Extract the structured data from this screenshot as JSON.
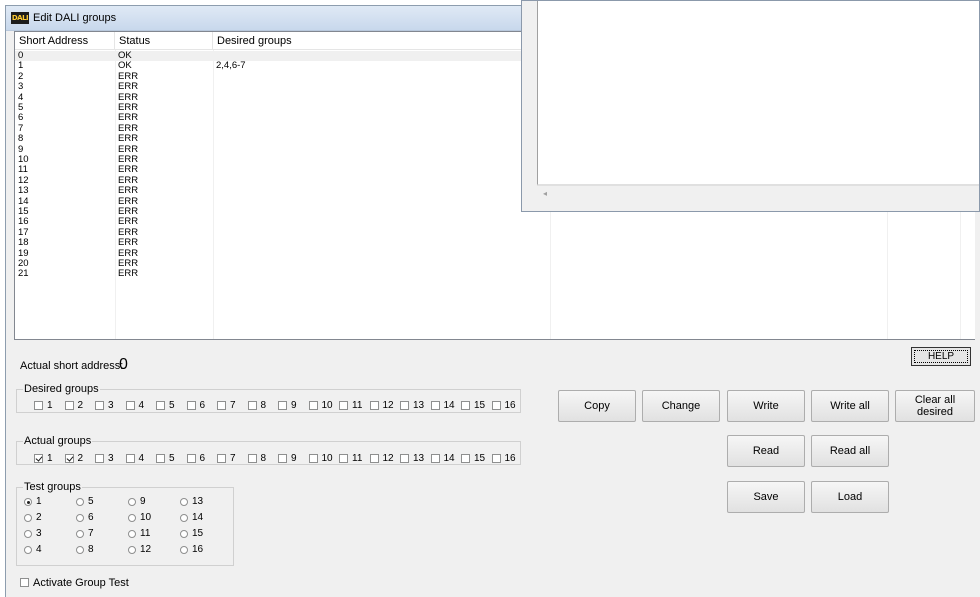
{
  "window": {
    "title": "Edit DALI groups",
    "icon_text": "DALI"
  },
  "list": {
    "columns": [
      "Short Address",
      "Status",
      "Desired groups"
    ],
    "rows": [
      {
        "address": "0",
        "status": "OK",
        "desired": ""
      },
      {
        "address": "1",
        "status": "OK",
        "desired": "2,4,6-7"
      },
      {
        "address": "2",
        "status": "ERR",
        "desired": ""
      },
      {
        "address": "3",
        "status": "ERR",
        "desired": ""
      },
      {
        "address": "4",
        "status": "ERR",
        "desired": ""
      },
      {
        "address": "5",
        "status": "ERR",
        "desired": ""
      },
      {
        "address": "6",
        "status": "ERR",
        "desired": ""
      },
      {
        "address": "7",
        "status": "ERR",
        "desired": ""
      },
      {
        "address": "8",
        "status": "ERR",
        "desired": ""
      },
      {
        "address": "9",
        "status": "ERR",
        "desired": ""
      },
      {
        "address": "10",
        "status": "ERR",
        "desired": ""
      },
      {
        "address": "11",
        "status": "ERR",
        "desired": ""
      },
      {
        "address": "12",
        "status": "ERR",
        "desired": ""
      },
      {
        "address": "13",
        "status": "ERR",
        "desired": ""
      },
      {
        "address": "14",
        "status": "ERR",
        "desired": ""
      },
      {
        "address": "15",
        "status": "ERR",
        "desired": ""
      },
      {
        "address": "16",
        "status": "ERR",
        "desired": ""
      },
      {
        "address": "17",
        "status": "ERR",
        "desired": ""
      },
      {
        "address": "18",
        "status": "ERR",
        "desired": ""
      },
      {
        "address": "19",
        "status": "ERR",
        "desired": ""
      },
      {
        "address": "20",
        "status": "ERR",
        "desired": ""
      },
      {
        "address": "21",
        "status": "ERR",
        "desired": ""
      }
    ]
  },
  "actual_short_address": {
    "label": "Actual short address:",
    "value": "0"
  },
  "help_label": "HELP",
  "desired_groups": {
    "legend": "Desired groups",
    "items": [
      {
        "label": "1",
        "checked": false
      },
      {
        "label": "2",
        "checked": false
      },
      {
        "label": "3",
        "checked": false
      },
      {
        "label": "4",
        "checked": false
      },
      {
        "label": "5",
        "checked": false
      },
      {
        "label": "6",
        "checked": false
      },
      {
        "label": "7",
        "checked": false
      },
      {
        "label": "8",
        "checked": false
      },
      {
        "label": "9",
        "checked": false
      },
      {
        "label": "10",
        "checked": false
      },
      {
        "label": "11",
        "checked": false
      },
      {
        "label": "12",
        "checked": false
      },
      {
        "label": "13",
        "checked": false
      },
      {
        "label": "14",
        "checked": false
      },
      {
        "label": "15",
        "checked": false
      },
      {
        "label": "16",
        "checked": false
      }
    ]
  },
  "actual_groups": {
    "legend": "Actual groups",
    "items": [
      {
        "label": "1",
        "checked": true
      },
      {
        "label": "2",
        "checked": true
      },
      {
        "label": "3",
        "checked": false
      },
      {
        "label": "4",
        "checked": false
      },
      {
        "label": "5",
        "checked": false
      },
      {
        "label": "6",
        "checked": false
      },
      {
        "label": "7",
        "checked": false
      },
      {
        "label": "8",
        "checked": false
      },
      {
        "label": "9",
        "checked": false
      },
      {
        "label": "10",
        "checked": false
      },
      {
        "label": "11",
        "checked": false
      },
      {
        "label": "12",
        "checked": false
      },
      {
        "label": "13",
        "checked": false
      },
      {
        "label": "14",
        "checked": false
      },
      {
        "label": "15",
        "checked": false
      },
      {
        "label": "16",
        "checked": false
      }
    ]
  },
  "test_groups": {
    "legend": "Test groups",
    "selected": "1",
    "items": [
      "1",
      "5",
      "9",
      "13",
      "2",
      "6",
      "10",
      "14",
      "3",
      "7",
      "11",
      "15",
      "4",
      "8",
      "12",
      "16"
    ]
  },
  "activate_group_test": {
    "label": "Activate Group Test",
    "checked": false
  },
  "buttons": {
    "copy": "Copy",
    "change": "Change",
    "write": "Write",
    "write_all": "Write all",
    "clear_all_desired": "Clear all desired",
    "read": "Read",
    "read_all": "Read all",
    "save": "Save",
    "load": "Load"
  }
}
